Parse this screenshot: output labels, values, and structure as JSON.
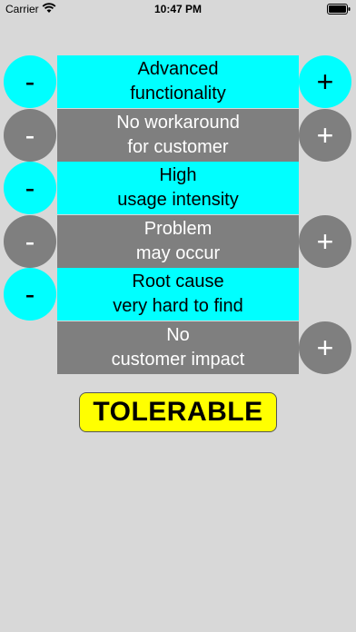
{
  "status_bar": {
    "carrier": "Carrier",
    "time": "10:47 PM"
  },
  "colors": {
    "active": "#00ffff",
    "inactive": "#7f7f7f",
    "result_bg": "#ffff00",
    "background": "#d8d8d8"
  },
  "rows": [
    {
      "line1": "Advanced",
      "line2": "functionality",
      "active": true,
      "minus_label": "-",
      "plus_label": "+",
      "show_minus": true,
      "show_plus": true
    },
    {
      "line1": "No workaround",
      "line2": "for customer",
      "active": false,
      "minus_label": "-",
      "plus_label": "+",
      "show_minus": true,
      "show_plus": true
    },
    {
      "line1": "High",
      "line2": "usage intensity",
      "active": true,
      "minus_label": "-",
      "plus_label": "+",
      "show_minus": true,
      "show_plus": false
    },
    {
      "line1": "Problem",
      "line2": "may occur",
      "active": false,
      "minus_label": "-",
      "plus_label": "+",
      "show_minus": true,
      "show_plus": true
    },
    {
      "line1": "Root cause",
      "line2": "very hard to find",
      "active": true,
      "minus_label": "-",
      "plus_label": "+",
      "show_minus": true,
      "show_plus": false
    },
    {
      "line1": "No",
      "line2": "customer impact",
      "active": false,
      "minus_label": "-",
      "plus_label": "+",
      "show_minus": false,
      "show_plus": true
    }
  ],
  "result": {
    "label": "TOLERABLE"
  }
}
